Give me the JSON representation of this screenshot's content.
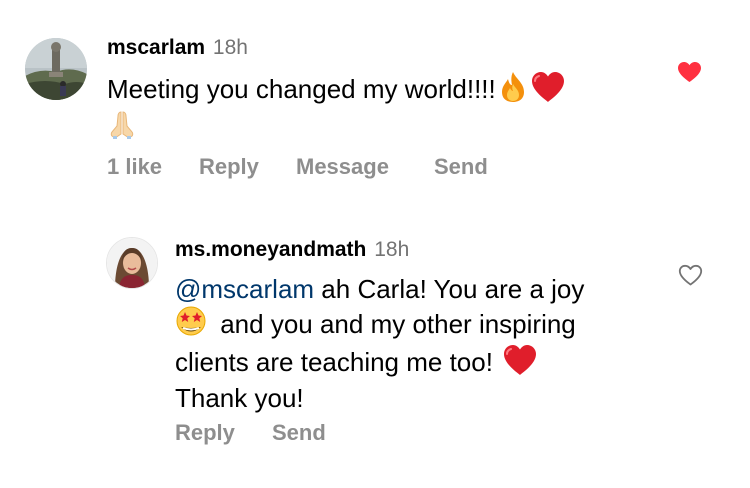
{
  "comments": [
    {
      "username": "mscarlam",
      "time": "18h",
      "text": "Meeting you changed my world!!!!",
      "emoji": [
        "fire-emoji",
        "red-heart-emoji",
        "folded-hands-emoji"
      ],
      "actions": {
        "likes": "1 like",
        "reply": "Reply",
        "message": "Message",
        "send": "Send"
      },
      "liked": true
    },
    {
      "username": "ms.moneyandmath",
      "time": "18h",
      "mention": "@mscarlam",
      "text_line1": " ah Carla! You are a joy",
      "text_line2": " and you and my other inspiring",
      "text_line3": "clients are teaching me too! ",
      "text_line4": "Thank you!",
      "emoji": [
        "star-struck-emoji",
        "red-heart-emoji"
      ],
      "actions": {
        "reply": "Reply",
        "send": "Send"
      },
      "liked": false
    }
  ],
  "colors": {
    "username": "#000000",
    "meta": "#737373",
    "action": "#8e8e8e",
    "mention": "#00376b",
    "like_red": "#ff3040"
  }
}
